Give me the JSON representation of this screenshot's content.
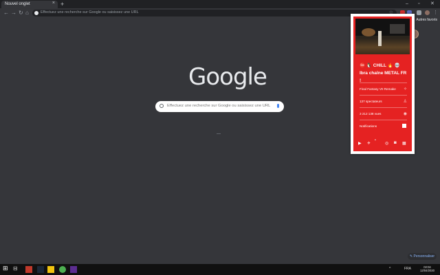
{
  "browser": {
    "tab_title": "Nouvel onglet",
    "tab_close": "×",
    "new_tab": "+",
    "omnibox_placeholder": "Effectuez une recherche sur Google ou saisissez une URL",
    "bookmark_folder": "Autres favoris",
    "window_controls": [
      "–",
      "▫",
      "✕"
    ]
  },
  "ntp": {
    "logo": "Google",
    "search_placeholder": "Effectuez une recherche sur Google ou saisissez une URL",
    "personalize_label": "✎ Personnaliser"
  },
  "popup": {
    "channel_title": "⛔ 🐧 CHILL 🔥 💀 Ibra chaîne METAL FR !",
    "game": "Final Fantasy VII Remake",
    "viewers": "137 spectateurs",
    "views": "3 212 138 vues",
    "notifications_label": "Notifications",
    "row_icons": [
      "✧",
      "♙",
      "◉"
    ],
    "social_icons": [
      "youtube-icon",
      "twitter-icon",
      "instagram-icon",
      "discord-icon",
      "store-icon"
    ]
  },
  "taskbar": {
    "time": "02:04",
    "date": "12/04/2020",
    "lang": "FRA",
    "start_icon": "⊞"
  },
  "colors": {
    "popup_red": "#e52222",
    "chrome_dark": "#35363a",
    "accent_blue": "#8ab4f8"
  }
}
